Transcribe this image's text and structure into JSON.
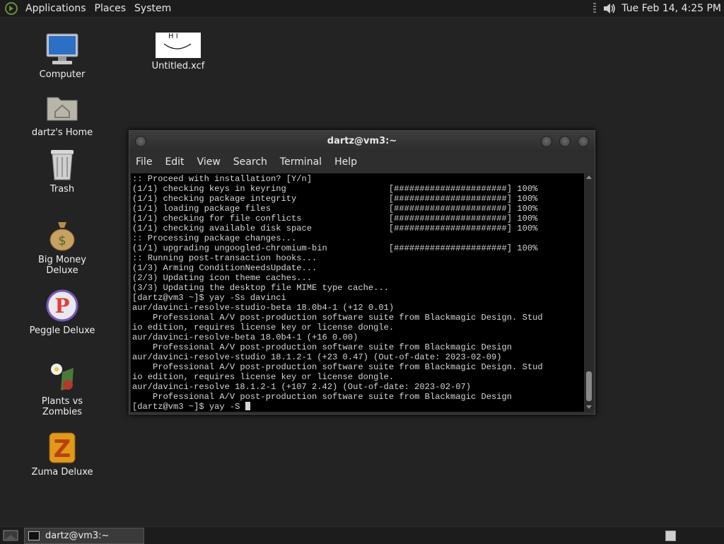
{
  "top_panel": {
    "menus": [
      "Applications",
      "Places",
      "System"
    ],
    "clock": "Tue Feb 14,  4:25 PM"
  },
  "desktop_icons": [
    {
      "label": "Computer",
      "icon": "computer-icon"
    },
    {
      "label": "dartz's Home",
      "icon": "home-folder-icon"
    },
    {
      "label": "Trash",
      "icon": "trash-icon"
    },
    {
      "label": "Big Money Deluxe",
      "icon": "money-bag-icon"
    },
    {
      "label": "Peggle Deluxe",
      "icon": "peggle-icon"
    },
    {
      "label": "Plants vs Zombies",
      "icon": "plants-vs-zombies-icon"
    },
    {
      "label": "Zuma Deluxe",
      "icon": "zuma-icon"
    },
    {
      "label": "Untitled.xcf",
      "icon": "image-file-icon",
      "thumbnail_text": "H I"
    }
  ],
  "terminal": {
    "title": "dartz@vm3:~",
    "menu": [
      "File",
      "Edit",
      "View",
      "Search",
      "Terminal",
      "Help"
    ],
    "lines": [
      ":: Proceed with installation? [Y/n]",
      "(1/1) checking keys in keyring                    [######################] 100%",
      "(1/1) checking package integrity                  [######################] 100%",
      "(1/1) loading package files                       [######################] 100%",
      "(1/1) checking for file conflicts                 [######################] 100%",
      "(1/1) checking available disk space               [######################] 100%",
      ":: Processing package changes...",
      "(1/1) upgrading ungoogled-chromium-bin            [######################] 100%",
      ":: Running post-transaction hooks...",
      "(1/3) Arming ConditionNeedsUpdate...",
      "(2/3) Updating icon theme caches...",
      "(3/3) Updating the desktop file MIME type cache...",
      "[dartz@vm3 ~]$ yay -Ss davinci",
      "aur/davinci-resolve-studio-beta 18.0b4-1 (+12 0.01)",
      "    Professional A/V post-production software suite from Blackmagic Design. Stud",
      "io edition, requires license key or license dongle.",
      "aur/davinci-resolve-beta 18.0b4-1 (+16 0.00)",
      "    Professional A/V post-production software suite from Blackmagic Design",
      "aur/davinci-resolve-studio 18.1.2-1 (+23 0.47) (Out-of-date: 2023-02-09)",
      "    Professional A/V post-production software suite from Blackmagic Design. Stud",
      "io edition, requires license key or license dongle.",
      "aur/davinci-resolve 18.1.2-1 (+107 2.42) (Out-of-date: 2023-02-07)",
      "    Professional A/V post-production software suite from Blackmagic Design",
      "[dartz@vm3 ~]$ yay -S "
    ]
  },
  "taskbar": {
    "window_button": "dartz@vm3:~"
  }
}
